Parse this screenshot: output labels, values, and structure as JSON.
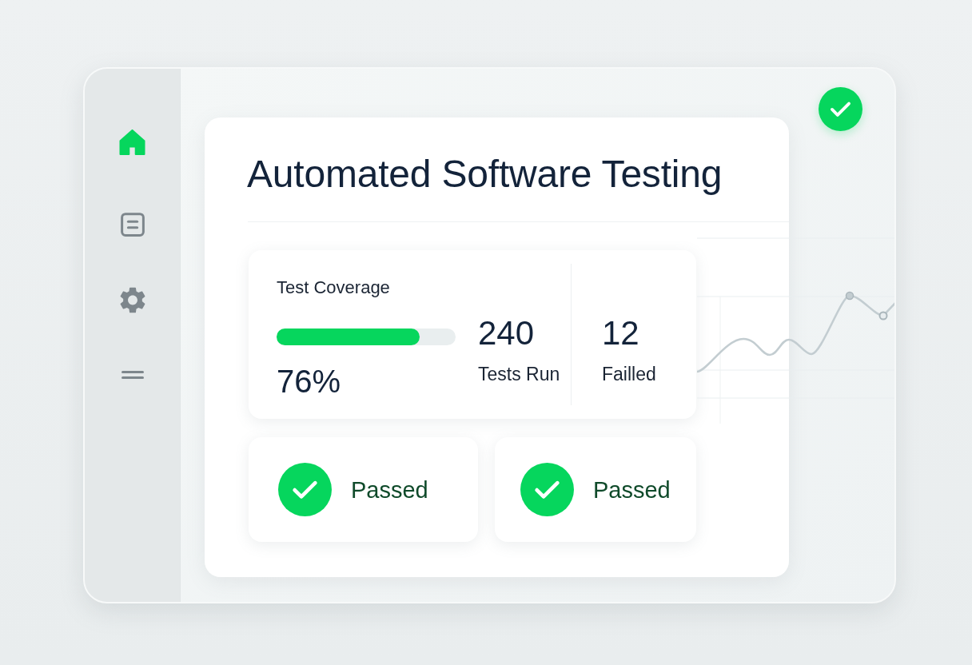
{
  "sidebar": {
    "items": [
      {
        "selected": true
      },
      {
        "selected": false
      },
      {
        "selected": false
      },
      {
        "selected": false
      }
    ]
  },
  "main": {
    "title": "Automated Software Testing",
    "coverage": {
      "label": "Test Coverage",
      "level": 0.8,
      "value": "76%"
    },
    "stats": [
      {
        "value": "240",
        "label": "Tests Run"
      },
      {
        "value": "12",
        "label": "Failled"
      }
    ],
    "results": [
      {
        "label": "Passed"
      },
      {
        "label": "Passed"
      }
    ]
  }
}
